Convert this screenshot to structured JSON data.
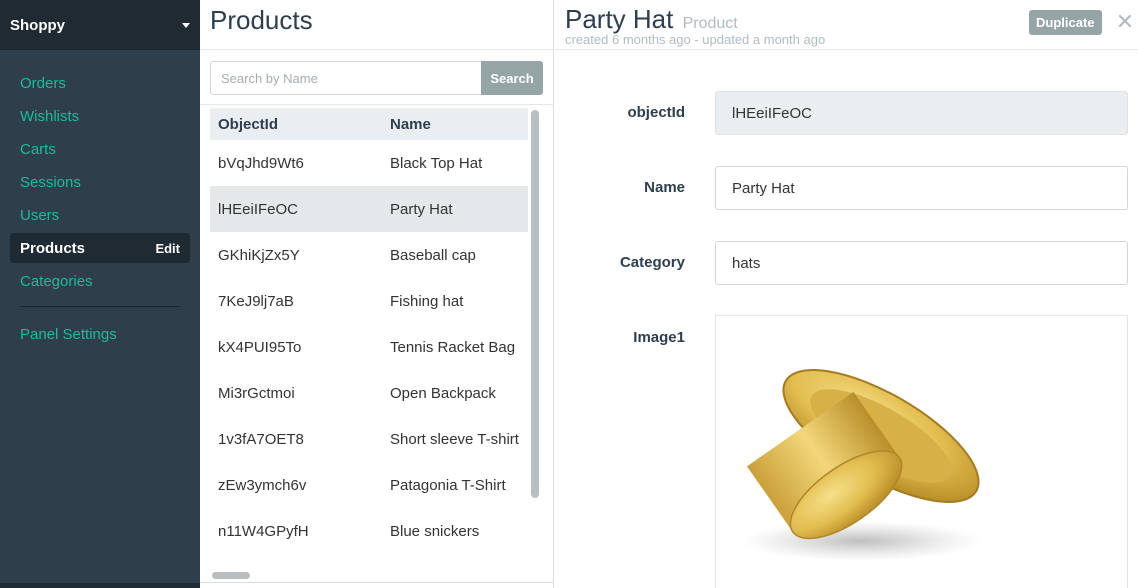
{
  "app": {
    "name": "Shoppy"
  },
  "sidebar": {
    "items": [
      {
        "label": "Orders"
      },
      {
        "label": "Wishlists"
      },
      {
        "label": "Carts"
      },
      {
        "label": "Sessions"
      },
      {
        "label": "Users"
      },
      {
        "label": "Products",
        "edit_label": "Edit",
        "active": true
      },
      {
        "label": "Categories"
      }
    ],
    "settings_label": "Panel Settings"
  },
  "list": {
    "title": "Products",
    "search_placeholder": "Search by Name",
    "search_label": "Search",
    "columns": [
      "ObjectId",
      "Name"
    ],
    "rows": [
      {
        "id": "bVqJhd9Wt6",
        "name": "Black Top Hat"
      },
      {
        "id": "lHEeiIFeOC",
        "name": "Party Hat"
      },
      {
        "id": "GKhiKjZx5Y",
        "name": "Baseball cap"
      },
      {
        "id": "7KeJ9lj7aB",
        "name": "Fishing hat"
      },
      {
        "id": "kX4PUI95To",
        "name": "Tennis Racket Bag"
      },
      {
        "id": "Mi3rGctmoi",
        "name": "Open Backpack"
      },
      {
        "id": "1v3fA7OET8",
        "name": "Short sleeve T-shirt"
      },
      {
        "id": "zEw3ymch6v",
        "name": "Patagonia T-Shirt"
      },
      {
        "id": "n11W4GPyfH",
        "name": "Blue snickers"
      }
    ]
  },
  "detail": {
    "title": "Party Hat",
    "type": "Product",
    "subtitle": "created 6 months ago - updated a month ago",
    "duplicate_label": "Duplicate",
    "close_glyph": "✕",
    "fields": [
      {
        "label": "objectId",
        "value": "lHEeiIFeOC",
        "readonly": true
      },
      {
        "label": "Name",
        "value": "Party Hat"
      },
      {
        "label": "Category",
        "value": "hats"
      }
    ],
    "image_label": "Image1"
  },
  "colors": {
    "accent": "#1abc9c",
    "sidebar": "#2e3e4b",
    "sidebar_dark": "#1f2a33",
    "button_gray": "#95a5a6"
  }
}
